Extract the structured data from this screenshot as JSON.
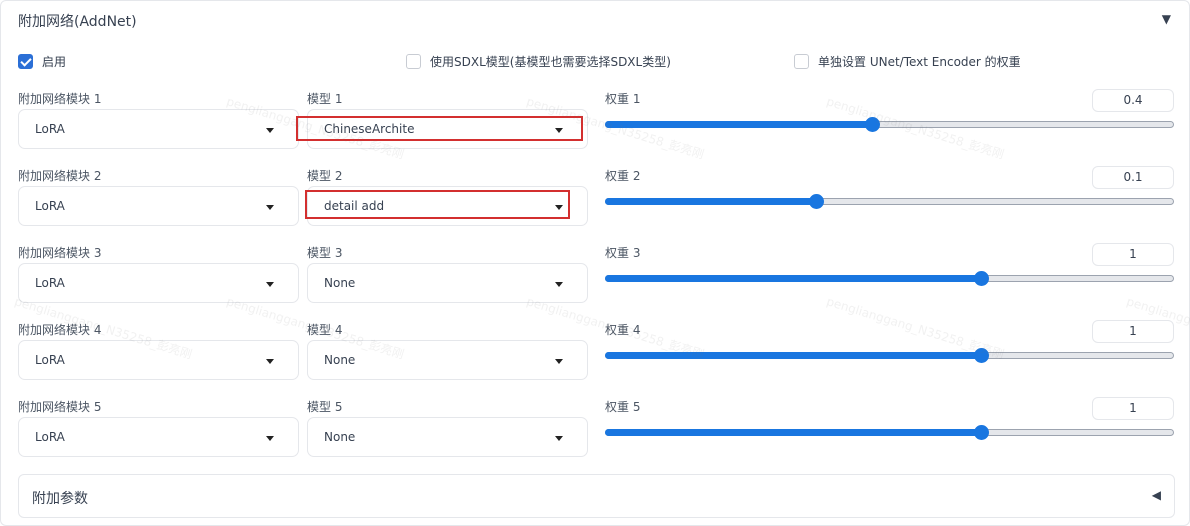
{
  "accordion": {
    "title": "附加网络(AddNet)",
    "toggle_icon": "triangle-down-icon"
  },
  "checkboxes": [
    {
      "label": "启用",
      "checked": true
    },
    {
      "label": "使用SDXL模型(基模型也需要选择SDXL类型)",
      "checked": false
    },
    {
      "label": "单独设置 UNet/Text Encoder 的权重",
      "checked": false
    }
  ],
  "rows": [
    {
      "module_label": "附加网络模块 1",
      "module_value": "LoRA",
      "model_label": "模型 1",
      "model_value": "ChineseArchite",
      "weight_label": "权重 1",
      "weight_value": "0.4",
      "slider_fraction": 0.47
    },
    {
      "module_label": "附加网络模块 2",
      "module_value": "LoRA",
      "model_label": "模型 2",
      "model_value": "detail add",
      "weight_label": "权重 2",
      "weight_value": "0.1",
      "slider_fraction": 0.37
    },
    {
      "module_label": "附加网络模块 3",
      "module_value": "LoRA",
      "model_label": "模型 3",
      "model_value": "None",
      "weight_label": "权重 3",
      "weight_value": "1",
      "slider_fraction": 0.66
    },
    {
      "module_label": "附加网络模块 4",
      "module_value": "LoRA",
      "model_label": "模型 4",
      "model_value": "None",
      "weight_label": "权重 4",
      "weight_value": "1",
      "slider_fraction": 0.66
    },
    {
      "module_label": "附加网络模块 5",
      "module_value": "LoRA",
      "model_label": "模型 5",
      "model_value": "None",
      "weight_label": "权重 5",
      "weight_value": "1",
      "slider_fraction": 0.66
    }
  ],
  "extra_params": {
    "title": "附加参数",
    "toggle_icon": "triangle-left-icon"
  },
  "colors": {
    "accent": "#1976e0",
    "checkbox": "#2b6fd6",
    "highlight": "#d32f2f"
  },
  "watermark": "penglianggang_N35258_彭亮刚"
}
